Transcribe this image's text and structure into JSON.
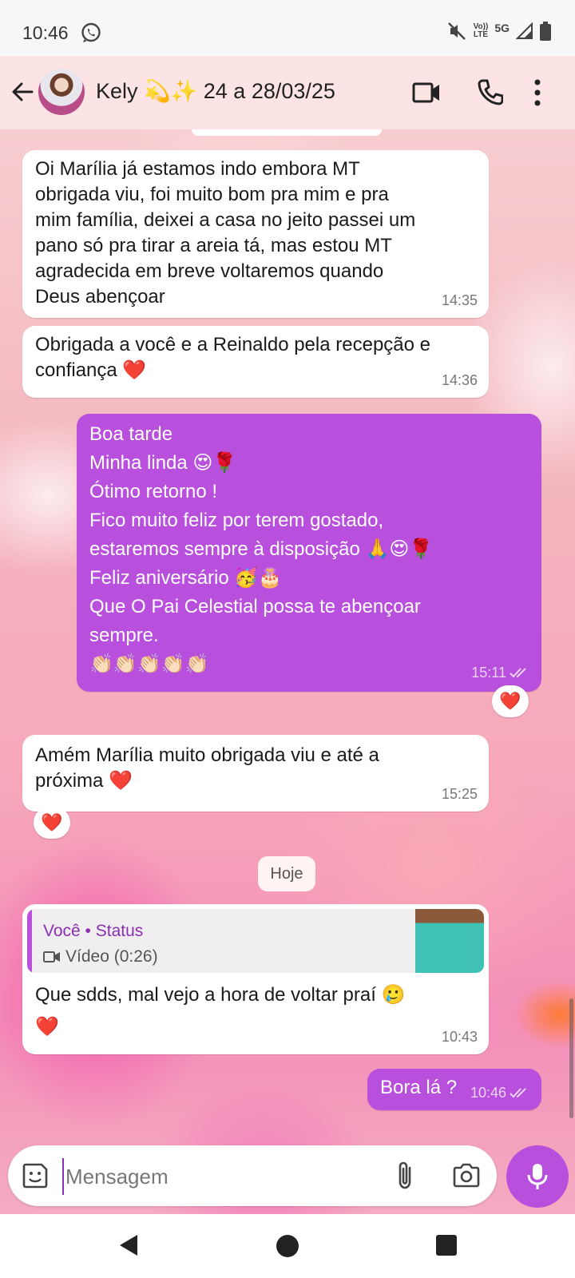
{
  "status_bar": {
    "time": "10:46",
    "volte_top": "Vo))",
    "volte_bottom": "LTE",
    "network": "5G"
  },
  "header": {
    "contact_name": "Kely 💫✨ 24 a 28/03/25"
  },
  "messages": [
    {
      "text": "Oi Marília já estamos indo embora MT\nobrigada viu, foi muito bom pra mim e pra\nmim família, deixei a casa no jeito passei um\npano só pra tirar a areia tá, mas estou MT\nagradecida em breve voltaremos quando\nDeus abençoar",
      "time": "14:35"
    },
    {
      "text": "Obrigada a você e a Reinaldo pela recepção e\nconfiança ❤️",
      "time": "14:36"
    },
    {
      "text": "Boa tarde\nMinha linda 😍🌹\nÓtimo retorno !\nFico muito feliz por terem gostado,\nestaremos sempre à disposição 🙏😍🌹\nFeliz aniversário 🥳🎂\nQue O Pai Celestial possa te abençoar\nsempre.\n👏🏻👏🏻👏🏻👏🏻👏🏻",
      "time": "15:11",
      "reaction": "❤️"
    },
    {
      "text": "Amém Marília muito obrigada viu e até a\npróxima ❤️",
      "time": "15:25",
      "reaction": "❤️"
    },
    {
      "quote_author": "Você • Status",
      "quote_subtitle": "Vídeo (0:26)",
      "text": "Que sdds, mal vejo a hora de voltar praí 🥲\n❤️",
      "time": "10:43"
    },
    {
      "text": "Bora lá ?",
      "time": "10:46"
    }
  ],
  "date_divider": "Hoje",
  "input": {
    "placeholder": "Mensagem"
  },
  "colors": {
    "outgoing_bubble": "#b94fdd",
    "incoming_bubble": "#ffffff",
    "header_bg": "#fce4e4"
  }
}
